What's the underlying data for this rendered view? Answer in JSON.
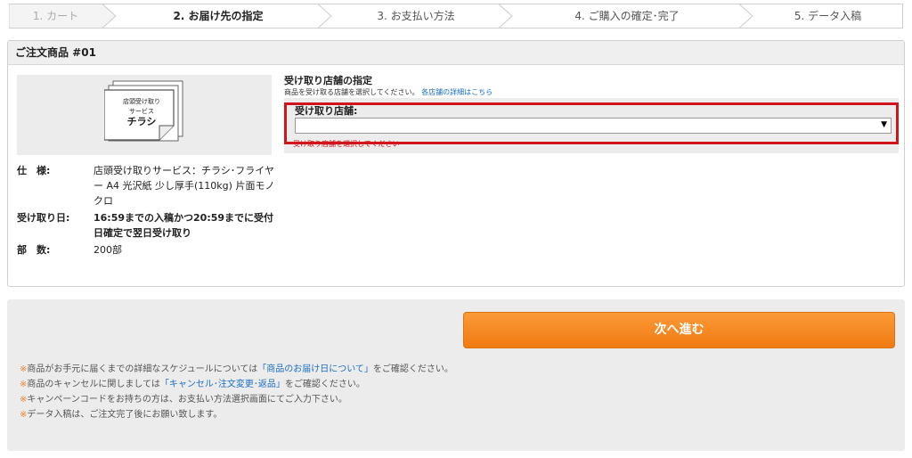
{
  "steps": [
    {
      "label": "1. カート",
      "state": "done"
    },
    {
      "label": "2. お届け先の指定",
      "state": "active"
    },
    {
      "label": "3. お支払い方法",
      "state": "pending"
    },
    {
      "label": "4. ご購入の確定･完了",
      "state": "pending"
    },
    {
      "label": "5. データ入稿",
      "state": "pending"
    }
  ],
  "order": {
    "header": "ご注文商品 #01",
    "image": {
      "line1": "店頭受け取り",
      "line2": "サービス",
      "line3": "チラシ"
    },
    "specs": {
      "spec_label": "仕　様:",
      "spec_value": "店頭受け取りサービス：チラシ･フライヤー A4 光沢紙 少し厚手(110kg) 片面モノクロ",
      "pickup_label": "受け取り日:",
      "pickup_value": "16:59までの入稿かつ20:59までに受付日確定で翌日受け取り",
      "qty_label": "部　数:",
      "qty_value": "200部"
    }
  },
  "store": {
    "title": "受け取り店舗の指定",
    "desc": "商品を受け取る店舗を選択してください。",
    "desc_link": "各店舗の詳細はこちら",
    "field_label": "受け取り店舗:",
    "selected": "",
    "error": "受け取り店舗を選択してください"
  },
  "actions": {
    "next_label": "次へ進む"
  },
  "notes": {
    "mark": "※",
    "n1_pre": "商品がお手元に届くまでの詳細なスケジュールについては",
    "n1_link": "「商品のお届け日について」",
    "n1_post": "をご確認ください。",
    "n2_pre": "商品のキャンセルに関しましては",
    "n2_link": "「キャンセル･注文変更･返品」",
    "n2_post": "をご確認ください。",
    "n3": "キャンペーンコードをお持ちの方は、お支払い方法選択画面にてご入力下さい。",
    "n4": "データ入稿は、ご注文完了後にお願い致します。"
  },
  "colors": {
    "accent_orange": "#f58a22",
    "error_red": "#c4161c",
    "link_blue": "#1a6fc0",
    "note_mark": "#e8873a"
  }
}
